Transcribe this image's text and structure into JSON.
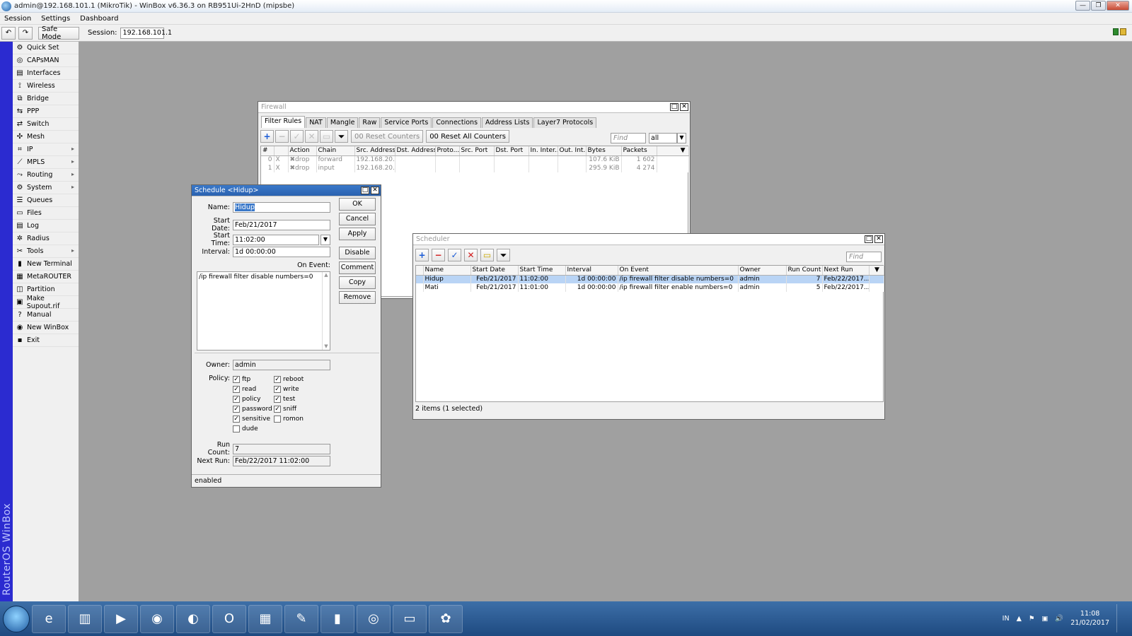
{
  "window": {
    "title": "admin@192.168.101.1 (MikroTik) - WinBox v6.36.3 on RB951Ui-2HnD (mipsbe)",
    "controls": [
      "—",
      "❐",
      "✕"
    ]
  },
  "menu": [
    "Session",
    "Settings",
    "Dashboard"
  ],
  "toolbar": {
    "safe_mode": "Safe Mode",
    "session_label": "Session:",
    "session_value": "192.168.101.1"
  },
  "sidebar": {
    "brand": "RouterOS WinBox",
    "items": [
      {
        "label": "Quick Set",
        "icon": "quick-set",
        "arrow": false
      },
      {
        "label": "CAPsMAN",
        "icon": "capsman",
        "arrow": false
      },
      {
        "label": "Interfaces",
        "icon": "interfaces",
        "arrow": false
      },
      {
        "label": "Wireless",
        "icon": "wireless",
        "arrow": false
      },
      {
        "label": "Bridge",
        "icon": "bridge",
        "arrow": false
      },
      {
        "label": "PPP",
        "icon": "ppp",
        "arrow": false
      },
      {
        "label": "Switch",
        "icon": "switch",
        "arrow": false
      },
      {
        "label": "Mesh",
        "icon": "mesh",
        "arrow": false
      },
      {
        "label": "IP",
        "icon": "ip",
        "arrow": true
      },
      {
        "label": "MPLS",
        "icon": "mpls",
        "arrow": true
      },
      {
        "label": "Routing",
        "icon": "routing",
        "arrow": true
      },
      {
        "label": "System",
        "icon": "system",
        "arrow": true
      },
      {
        "label": "Queues",
        "icon": "queues",
        "arrow": false
      },
      {
        "label": "Files",
        "icon": "files",
        "arrow": false
      },
      {
        "label": "Log",
        "icon": "log",
        "arrow": false
      },
      {
        "label": "Radius",
        "icon": "radius",
        "arrow": false
      },
      {
        "label": "Tools",
        "icon": "tools",
        "arrow": true
      },
      {
        "label": "New Terminal",
        "icon": "terminal",
        "arrow": false
      },
      {
        "label": "MetaROUTER",
        "icon": "metarouter",
        "arrow": false
      },
      {
        "label": "Partition",
        "icon": "partition",
        "arrow": false
      },
      {
        "label": "Make Supout.rif",
        "icon": "supout",
        "arrow": false
      },
      {
        "label": "Manual",
        "icon": "manual",
        "arrow": false
      },
      {
        "label": "New WinBox",
        "icon": "winbox",
        "arrow": false
      },
      {
        "label": "Exit",
        "icon": "exit",
        "arrow": false
      }
    ]
  },
  "firewall": {
    "title": "Firewall",
    "tabs": [
      "Filter Rules",
      "NAT",
      "Mangle",
      "Raw",
      "Service Ports",
      "Connections",
      "Address Lists",
      "Layer7 Protocols"
    ],
    "reset_counters": "00 Reset Counters",
    "reset_all_counters": "00 Reset All Counters",
    "find_placeholder": "Find",
    "filter_value": "all",
    "columns": [
      "#",
      "Action",
      "Chain",
      "Src. Address",
      "Dst. Address",
      "Proto...",
      "Src. Port",
      "Dst. Port",
      "In. Inter...",
      "Out. Int...",
      "Bytes",
      "Packets"
    ],
    "rows": [
      {
        "num": "0",
        "flag": "X",
        "action": "drop",
        "chain": "forward",
        "src": "192.168.20...",
        "bytes": "107.6 KiB",
        "packets": "1 602"
      },
      {
        "num": "1",
        "flag": "X",
        "action": "drop",
        "chain": "input",
        "src": "192.168.20...",
        "bytes": "295.9 KiB",
        "packets": "4 274"
      }
    ]
  },
  "schedule": {
    "title": "Schedule <Hidup>",
    "labels": {
      "name": "Name:",
      "start_date": "Start Date:",
      "start_time": "Start Time:",
      "interval": "Interval:",
      "on_event": "On Event:",
      "owner": "Owner:",
      "policy": "Policy:",
      "run_count": "Run Count:",
      "next_run": "Next Run:"
    },
    "name": "Hidup",
    "start_date": "Feb/21/2017",
    "start_time": "11:02:00",
    "interval": "1d 00:00:00",
    "on_event": "/ip firewall filter disable numbers=0",
    "owner": "admin",
    "run_count": "7",
    "next_run": "Feb/22/2017 11:02:00",
    "buttons": [
      "OK",
      "Cancel",
      "Apply",
      "Disable",
      "Comment",
      "Copy",
      "Remove"
    ],
    "policies_left": [
      {
        "label": "ftp",
        "checked": true
      },
      {
        "label": "read",
        "checked": true
      },
      {
        "label": "policy",
        "checked": true
      },
      {
        "label": "password",
        "checked": true
      },
      {
        "label": "sensitive",
        "checked": true
      },
      {
        "label": "dude",
        "checked": false
      }
    ],
    "policies_right": [
      {
        "label": "reboot",
        "checked": true
      },
      {
        "label": "write",
        "checked": true
      },
      {
        "label": "test",
        "checked": true
      },
      {
        "label": "sniff",
        "checked": true
      },
      {
        "label": "romon",
        "checked": false
      }
    ],
    "status": "enabled"
  },
  "scheduler": {
    "title": "Scheduler",
    "find_placeholder": "Find",
    "columns": [
      "Name",
      "Start Date",
      "Start Time",
      "Interval",
      "On Event",
      "Owner",
      "Run Count",
      "Next Run"
    ],
    "rows": [
      {
        "name": "Hidup",
        "start_date": "Feb/21/2017",
        "start_time": "11:02:00",
        "interval": "1d 00:00:00",
        "on_event": "/ip firewall filter disable numbers=0",
        "owner": "admin",
        "run_count": "7",
        "next_run": "Feb/22/2017...",
        "selected": true
      },
      {
        "name": "Mati",
        "start_date": "Feb/21/2017",
        "start_time": "11:01:00",
        "interval": "1d 00:00:00",
        "on_event": "/ip firewall filter enable numbers=0",
        "owner": "admin",
        "run_count": "5",
        "next_run": "Feb/22/2017...",
        "selected": false
      }
    ],
    "status": "2 items (1 selected)"
  },
  "taskbar": {
    "apps": [
      "ie",
      "explorer",
      "media",
      "chrome",
      "firefox",
      "opera",
      "network",
      "tools",
      "cmd",
      "winbox",
      "window",
      "paint"
    ],
    "lang": "IN",
    "time": "11:08",
    "date": "21/02/2017"
  },
  "colors": {
    "accent": "#2b2bd0",
    "selection": "#b9d4f5",
    "taskbar": "#1e4a80"
  }
}
